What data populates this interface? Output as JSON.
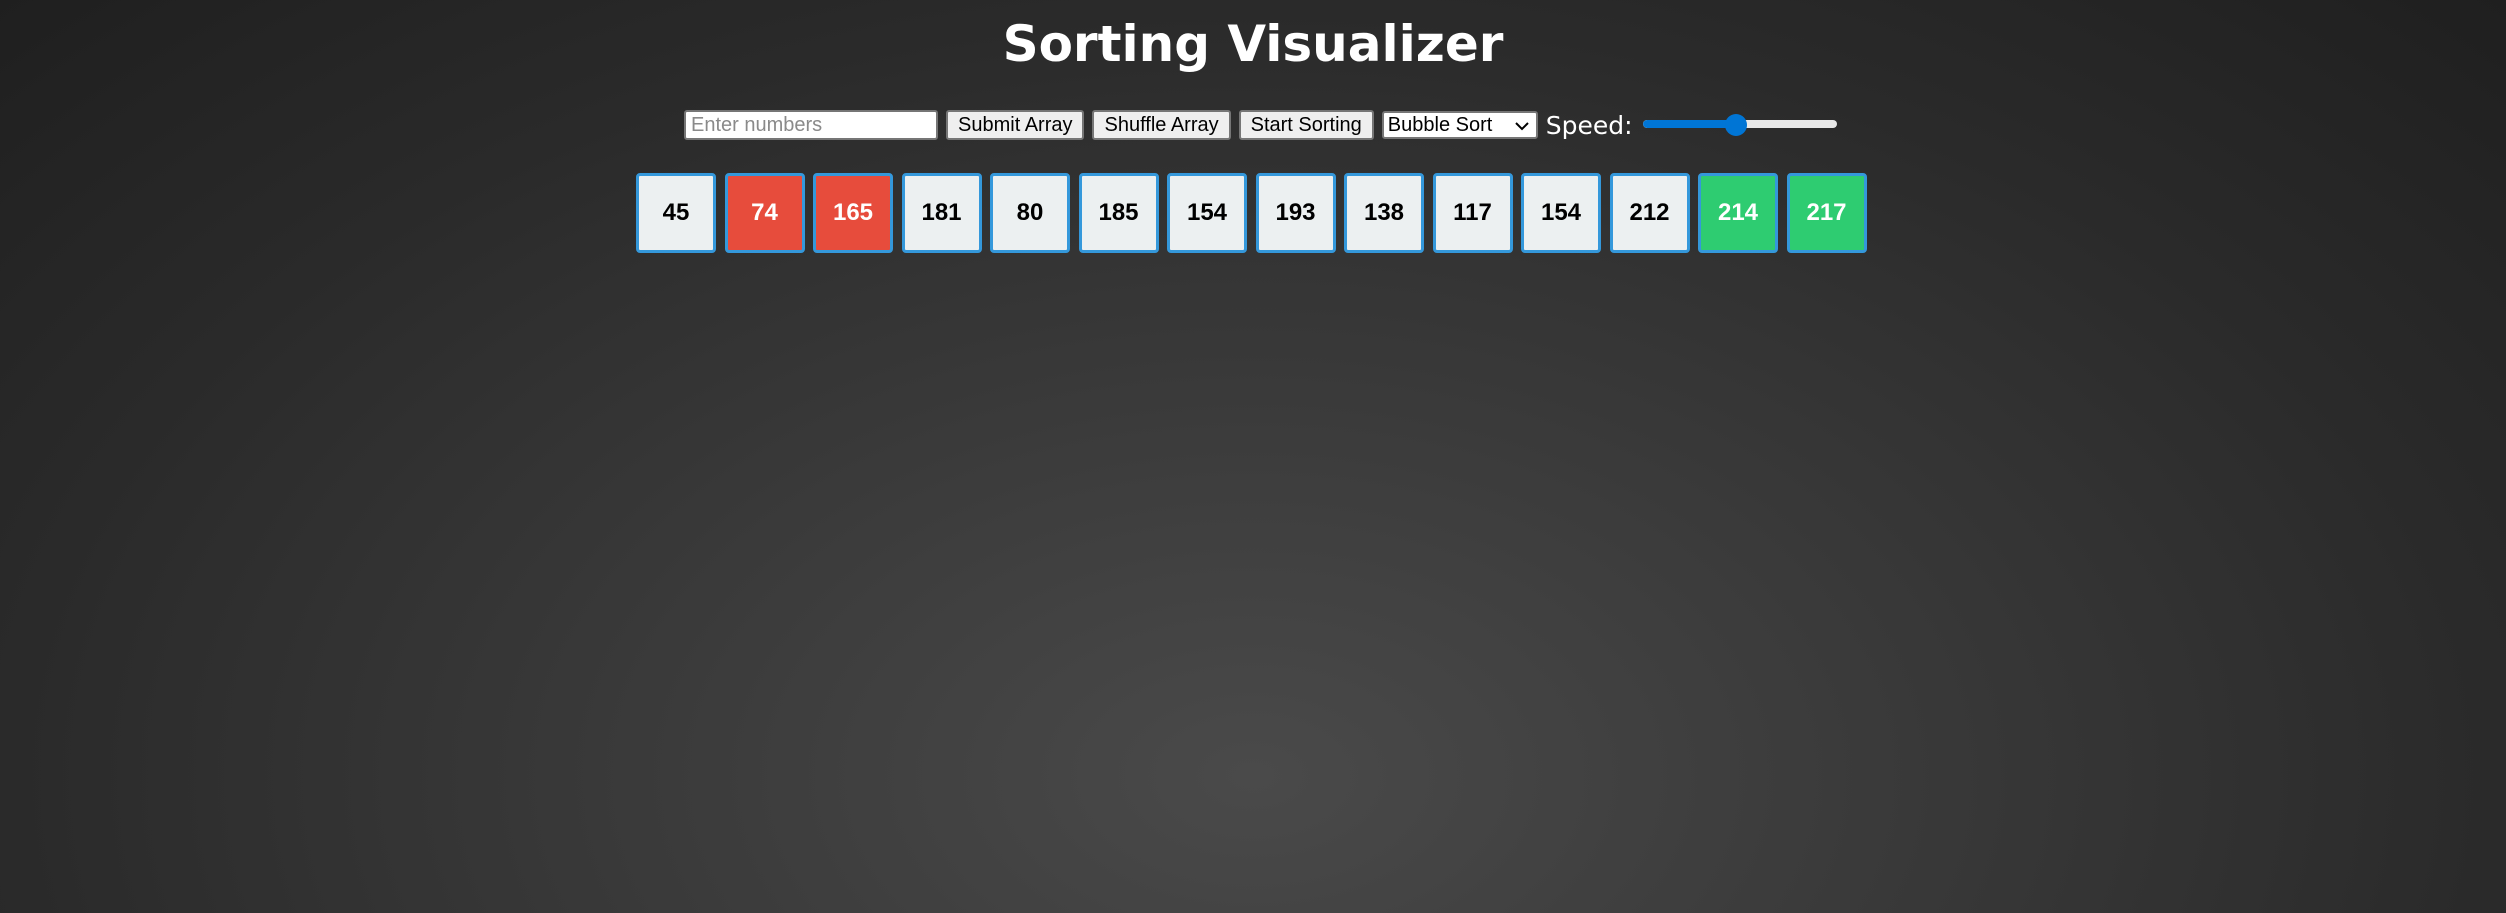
{
  "page": {
    "title": "Sorting Visualizer"
  },
  "controls": {
    "input_placeholder": "Enter numbers",
    "input_value": "",
    "submit_label": "Submit Array",
    "shuffle_label": "Shuffle Array",
    "start_label": "Start Sorting",
    "algorithm_selected": "Bubble Sort",
    "algorithm_chevron_icon": "chevron-down-icon",
    "speed_label": "Speed:",
    "speed_value_fraction": 0.48,
    "slider_color": "#0075d5"
  },
  "array": {
    "state_colors": {
      "default": "#ecf0f1",
      "comparing": "#e74c3c",
      "sorted": "#2ecc71",
      "border": "#3498db"
    },
    "items": [
      {
        "value": "45",
        "state": "default"
      },
      {
        "value": "74",
        "state": "comparing"
      },
      {
        "value": "165",
        "state": "comparing"
      },
      {
        "value": "181",
        "state": "default"
      },
      {
        "value": "80",
        "state": "default"
      },
      {
        "value": "185",
        "state": "default"
      },
      {
        "value": "154",
        "state": "default"
      },
      {
        "value": "193",
        "state": "default"
      },
      {
        "value": "138",
        "state": "default"
      },
      {
        "value": "117",
        "state": "default"
      },
      {
        "value": "154",
        "state": "default"
      },
      {
        "value": "212",
        "state": "default"
      },
      {
        "value": "214",
        "state": "sorted"
      },
      {
        "value": "217",
        "state": "sorted"
      }
    ]
  }
}
